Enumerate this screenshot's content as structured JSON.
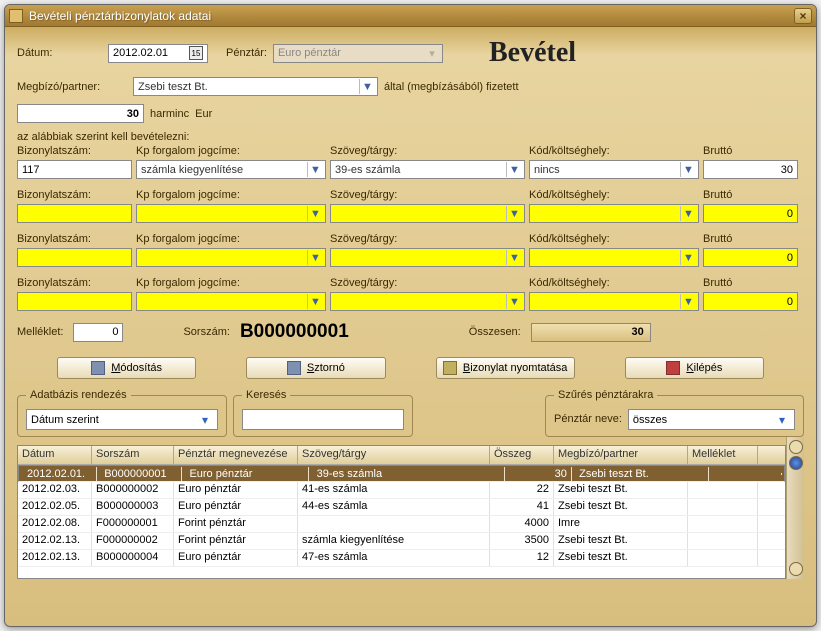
{
  "window": {
    "title": "Bevételi pénztárbizonylatok adatai"
  },
  "header": {
    "date_label": "Dátum:",
    "date_value": "2012.02.01",
    "cashreg_label": "Pénztár:",
    "cashreg_value": "Euro pénztár",
    "big_title": "Bevétel",
    "partner_label": "Megbízó/partner:",
    "partner_value": "Zsebi teszt Bt.",
    "partner_suffix": "által (megbízásából) fizetett",
    "amount_value": "30",
    "amount_words": "harminc",
    "currency": "Eur",
    "instr": "az alábbiak szerint kell bevételezni:"
  },
  "cols": {
    "c0": "Bizonylatszám:",
    "c1": "Kp forgalom jogcíme:",
    "c2": "Szöveg/tárgy:",
    "c3": "Kód/költséghely:",
    "c4": "Bruttó"
  },
  "lines": [
    {
      "no": "117",
      "title": "számla kiegyenlítése",
      "subj": "39-es számla",
      "code": "nincs",
      "gross": "30",
      "y": false
    },
    {
      "no": "",
      "title": "",
      "subj": "",
      "code": "",
      "gross": "0",
      "y": true
    },
    {
      "no": "",
      "title": "",
      "subj": "",
      "code": "",
      "gross": "0",
      "y": true
    },
    {
      "no": "",
      "title": "",
      "subj": "",
      "code": "",
      "gross": "0",
      "y": true
    }
  ],
  "totals": {
    "attach_label": "Melléklet:",
    "attach_value": "0",
    "serial_label": "Sorszám:",
    "serial_value": "B000000001",
    "total_label": "Összesen:",
    "total_value": "30"
  },
  "buttons": {
    "modify": "Módosítás",
    "storno": "Sztornó",
    "print": "Bizonylat nyomtatása",
    "exit": "Kilépés"
  },
  "filters": {
    "order_legend": "Adatbázis rendezés",
    "order_value": "Dátum szerint",
    "search_legend": "Keresés",
    "search_value": "",
    "cash_legend": "Szűrés pénztárakra",
    "cash_label": "Pénztár neve:",
    "cash_value": "összes"
  },
  "table": {
    "headers": [
      "Dátum",
      "Sorszám",
      "Pénztár megnevezése",
      "Szöveg/tárgy",
      "Összeg",
      "Megbízó/partner",
      "Melléklet"
    ],
    "rows": [
      {
        "d": "2012.02.01.",
        "s": "B000000001",
        "p": "Euro pénztár",
        "t": "39-es számla",
        "a": "30",
        "m": "Zsebi teszt Bt.",
        "mm": ""
      },
      {
        "d": "2012.02.03.",
        "s": "B000000002",
        "p": "Euro pénztár",
        "t": "41-es számla",
        "a": "22",
        "m": "Zsebi teszt Bt.",
        "mm": ""
      },
      {
        "d": "2012.02.05.",
        "s": "B000000003",
        "p": "Euro pénztár",
        "t": "44-es számla",
        "a": "41",
        "m": "Zsebi teszt Bt.",
        "mm": ""
      },
      {
        "d": "2012.02.08.",
        "s": "F000000001",
        "p": "Forint pénztár",
        "t": "",
        "a": "4000",
        "m": "Imre",
        "mm": ""
      },
      {
        "d": "2012.02.13.",
        "s": "F000000002",
        "p": "Forint pénztár",
        "t": "számla kiegyenlítése",
        "a": "3500",
        "m": "Zsebi teszt Bt.",
        "mm": ""
      },
      {
        "d": "2012.02.13.",
        "s": "B000000004",
        "p": "Euro pénztár",
        "t": "47-es számla",
        "a": "12",
        "m": "Zsebi teszt Bt.",
        "mm": ""
      }
    ]
  },
  "chart_data": null
}
